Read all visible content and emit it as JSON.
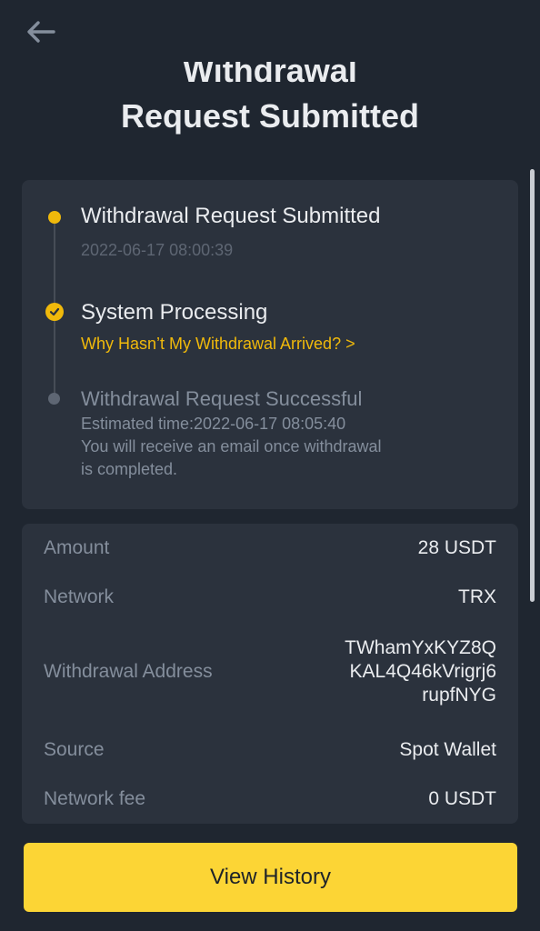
{
  "header": {
    "back_icon": "arrow-left-icon",
    "title_line1": "Withdrawal",
    "title_line2": "Request Submitted"
  },
  "timeline": {
    "steps": [
      {
        "title": "Withdrawal Request Submitted",
        "subtitle": "2022-06-17 08:00:39",
        "state": "active"
      },
      {
        "title": "System Processing",
        "link": "Why Hasn’t My Withdrawal Arrived? >",
        "state": "processing"
      },
      {
        "title": "Withdrawal Request Successful",
        "estimated": "Estimated time:2022-06-17 08:05:40",
        "note_line1": "You will receive an email once withdrawal",
        "note_line2": "is completed.",
        "state": "pending"
      }
    ]
  },
  "details": {
    "amount_label": "Amount",
    "amount_value": "28 USDT",
    "network_label": "Network",
    "network_value": "TRX",
    "address_label": "Withdrawal Address",
    "address_lines": [
      "TWhamYxKYZ8Q",
      "KAL4Q46kVrigrj6",
      "rupfNYG"
    ],
    "source_label": "Source",
    "source_value": "Spot Wallet",
    "fee_label": "Network fee",
    "fee_value": "0 USDT"
  },
  "cta": {
    "label": "View History"
  },
  "colors": {
    "background": "#1f2630",
    "card": "#2b323d",
    "accent": "#f0b90b",
    "button": "#fcd535"
  }
}
